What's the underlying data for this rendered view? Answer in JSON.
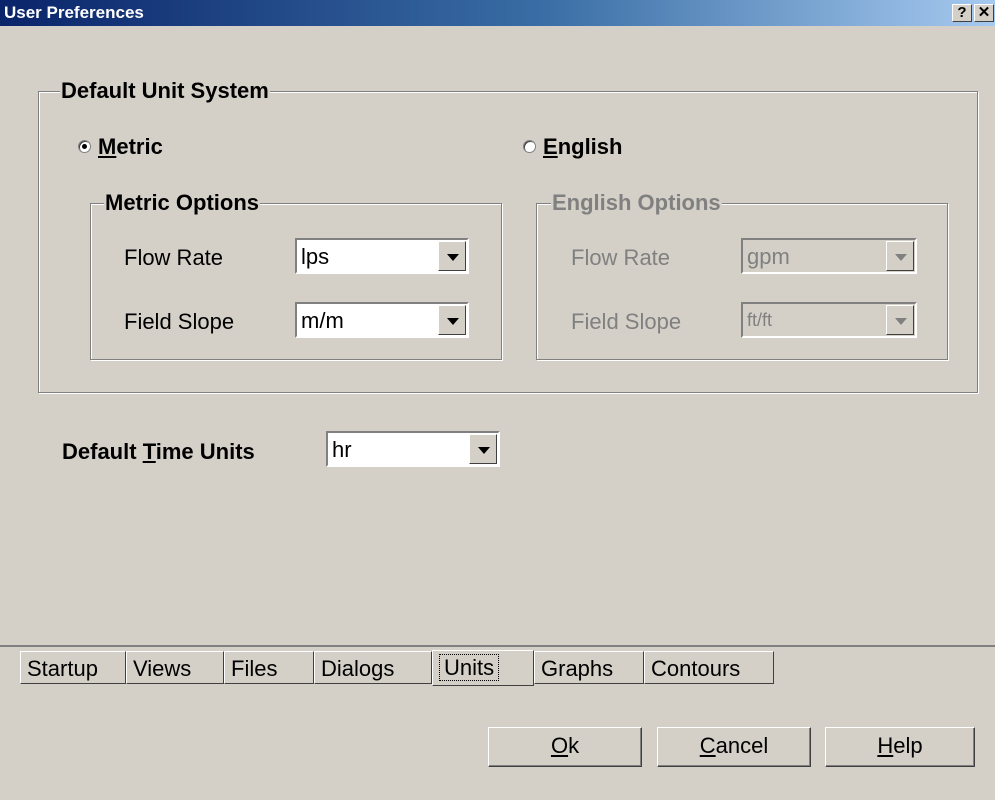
{
  "window": {
    "title": "User Preferences",
    "help_glyph": "?",
    "close_glyph": "✕"
  },
  "unit_system": {
    "legend": "Default Unit System",
    "metric": {
      "label_mn": "M",
      "label_rest": "etric",
      "selected": true
    },
    "english": {
      "label_mn": "E",
      "label_rest": "nglish",
      "selected": false
    }
  },
  "metric_options": {
    "legend": "Metric Options",
    "flow_rate_label": "Flow Rate",
    "flow_rate_value": "lps",
    "field_slope_label": "Field Slope",
    "field_slope_value": "m/m"
  },
  "english_options": {
    "legend": "English Options",
    "flow_rate_label": "Flow Rate",
    "flow_rate_value": "gpm",
    "field_slope_label": "Field Slope",
    "field_slope_value": "ft/ft",
    "enabled": false
  },
  "time_units": {
    "label_pre": "Default ",
    "label_mn": "T",
    "label_rest": "ime Units",
    "value": "hr"
  },
  "tabs": [
    {
      "label": "Startup"
    },
    {
      "label": "Views"
    },
    {
      "label": "Files"
    },
    {
      "label": "Dialogs"
    },
    {
      "label": "Units",
      "active": true
    },
    {
      "label": "Graphs"
    },
    {
      "label": "Contours"
    }
  ],
  "buttons": {
    "ok": {
      "mn": "O",
      "rest": "k"
    },
    "cancel": {
      "mn": "C",
      "rest": "ancel"
    },
    "help": {
      "mn": "H",
      "rest": "elp"
    }
  },
  "colors": {
    "face": "#d4d0c8",
    "title_start": "#0a246a",
    "title_end": "#a6caf0",
    "disabled_text": "#808080"
  }
}
